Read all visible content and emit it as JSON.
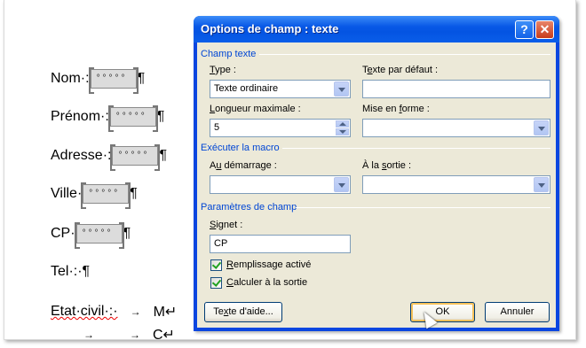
{
  "document": {
    "lines": [
      {
        "label": "Nom·:",
        "has_field": true,
        "field_dots": "°°°°°",
        "suffix": "¶"
      },
      {
        "label": "Prénom·:",
        "has_field": true,
        "field_dots": "°°°°°",
        "suffix": "¶"
      },
      {
        "label": "Adresse·:",
        "has_field": true,
        "field_dots": "°°°°°",
        "suffix": "¶"
      },
      {
        "label": "Ville·",
        "has_field": true,
        "field_dots": "°°°°°",
        "suffix": "¶"
      },
      {
        "label": "CP·",
        "has_field": true,
        "field_dots": "°°°°°",
        "suffix": "¶"
      },
      {
        "label": "Tel·:·¶",
        "has_field": false
      },
      {
        "label": "Etat·civil·:·",
        "tab_text": "→",
        "after_tab": "M↵"
      },
      {
        "label": "",
        "tab_text": "→",
        "after_tab": "C↵"
      }
    ]
  },
  "dialog": {
    "title": "Options de champ : texte",
    "help_label": "?",
    "close_label": "✕",
    "groups": {
      "champ_texte": "Champ texte",
      "executer_macro": "Exécuter la macro",
      "parametres": "Paramètres de champ"
    },
    "labels": {
      "type": "Type :",
      "texte_defaut": "Texte par défaut :",
      "longueur": "Longueur maximale :",
      "mise_en_forme": "Mise en forme :",
      "au_demarrage": "Au démarrage :",
      "a_la_sortie": "À la sortie :",
      "signet": "Signet :"
    },
    "values": {
      "type": "Texte ordinaire",
      "texte_defaut": "",
      "longueur": "5",
      "mise_en_forme": "",
      "au_demarrage": "",
      "a_la_sortie": "",
      "signet": "CP"
    },
    "checkboxes": {
      "remplissage": {
        "label": "Remplissage activé",
        "checked": true
      },
      "calculer": {
        "label": "Calculer à la sortie",
        "checked": true
      }
    },
    "buttons": {
      "aide": "Texte d'aide...",
      "ok": "OK",
      "annuler": "Annuler"
    }
  }
}
